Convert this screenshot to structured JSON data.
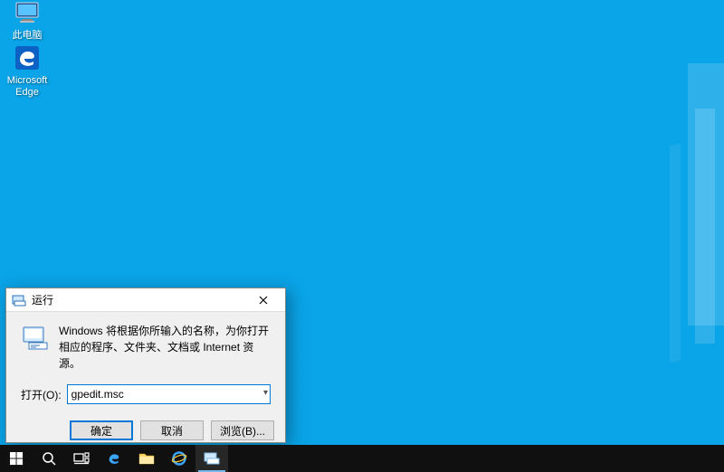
{
  "desktop": {
    "icons": [
      {
        "name": "此电脑"
      },
      {
        "name": "Microsoft Edge"
      }
    ]
  },
  "run_dialog": {
    "title": "运行",
    "message": "Windows 将根据你所输入的名称，为你打开相应的程序、文件夹、文档或 Internet 资源。",
    "open_label": "打开(O):",
    "open_value": "gpedit.msc",
    "buttons": {
      "ok": "确定",
      "cancel": "取消",
      "browse": "浏览(B)..."
    },
    "close_tooltip": "关闭"
  },
  "taskbar": {
    "items": [
      "start",
      "search",
      "task-view",
      "edge",
      "file-explorer",
      "ie",
      "run"
    ]
  }
}
